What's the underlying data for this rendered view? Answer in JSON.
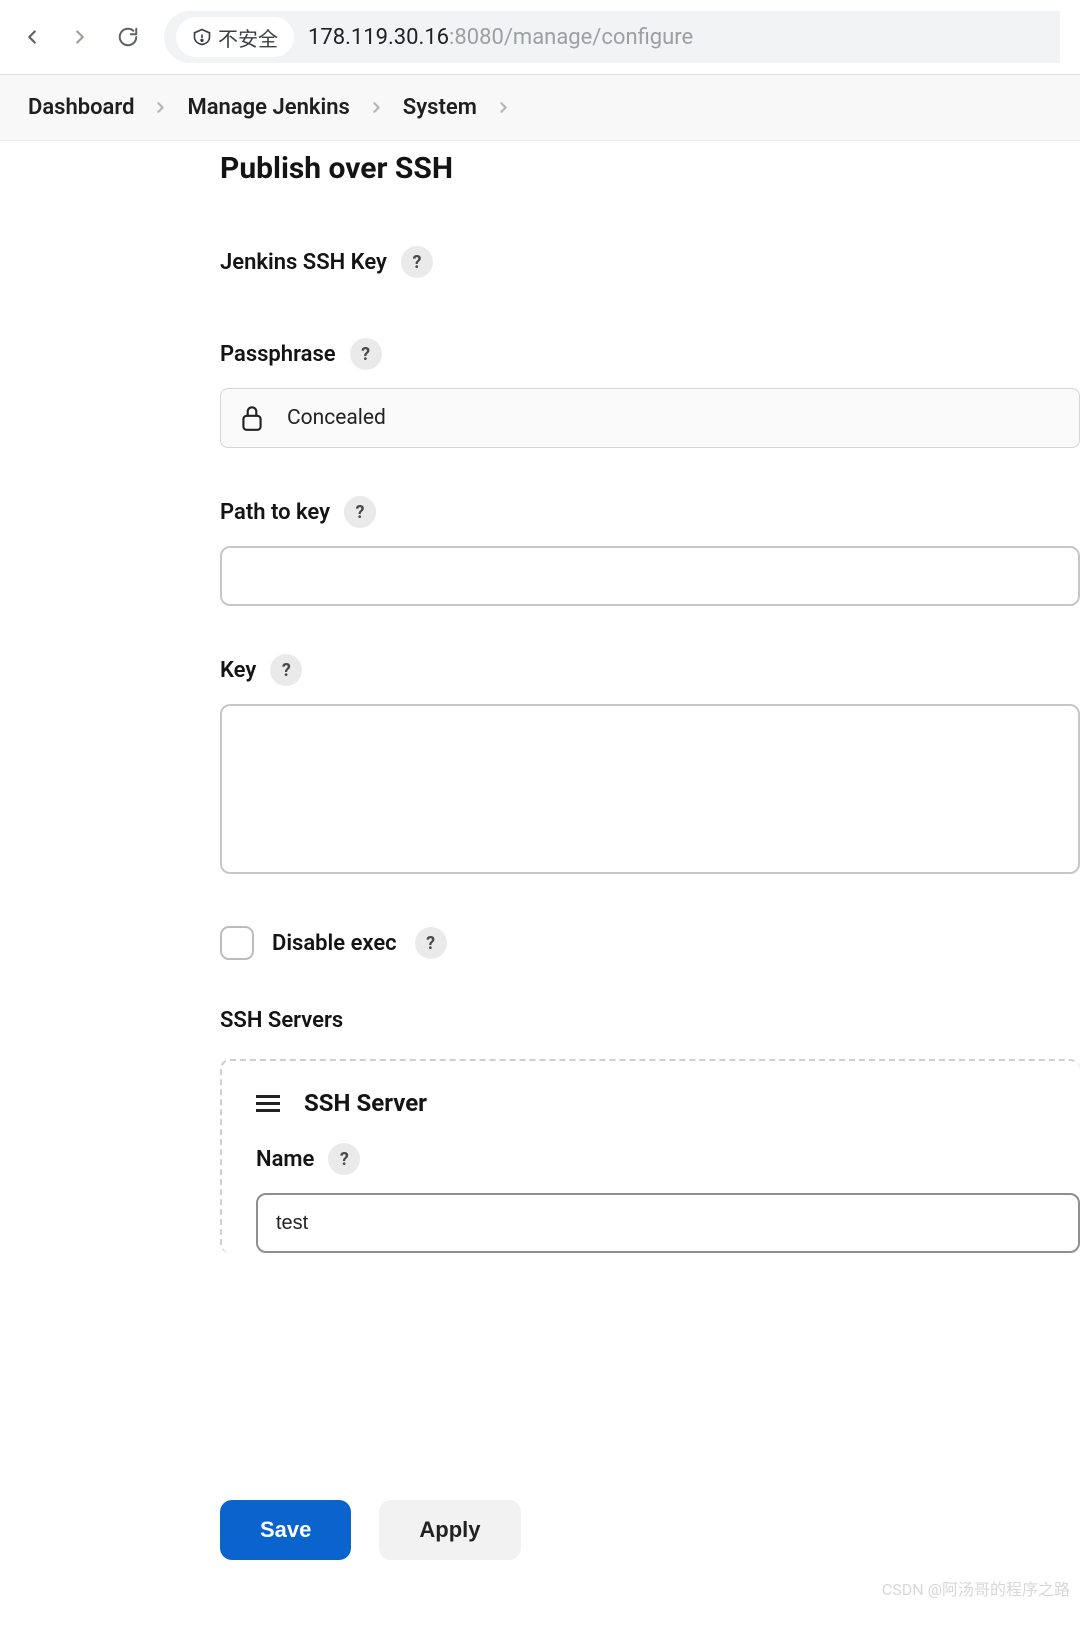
{
  "browser": {
    "security_label": "不安全",
    "url_host": "178.119.30.16",
    "url_port_path": ":8080/manage/configure"
  },
  "breadcrumb": {
    "items": [
      "Dashboard",
      "Manage Jenkins",
      "System"
    ]
  },
  "section": {
    "title": "Publish over SSH",
    "ssh_key_label": "Jenkins SSH Key",
    "passphrase_label": "Passphrase",
    "passphrase_value": "Concealed",
    "path_to_key_label": "Path to key",
    "path_to_key_value": "",
    "key_label": "Key",
    "key_value": "",
    "disable_exec_label": "Disable exec",
    "ssh_servers_label": "SSH Servers",
    "server": {
      "title": "SSH Server",
      "name_label": "Name",
      "name_value": "test"
    }
  },
  "buttons": {
    "save": "Save",
    "apply": "Apply"
  },
  "watermark": "CSDN @阿汤哥的程序之路"
}
